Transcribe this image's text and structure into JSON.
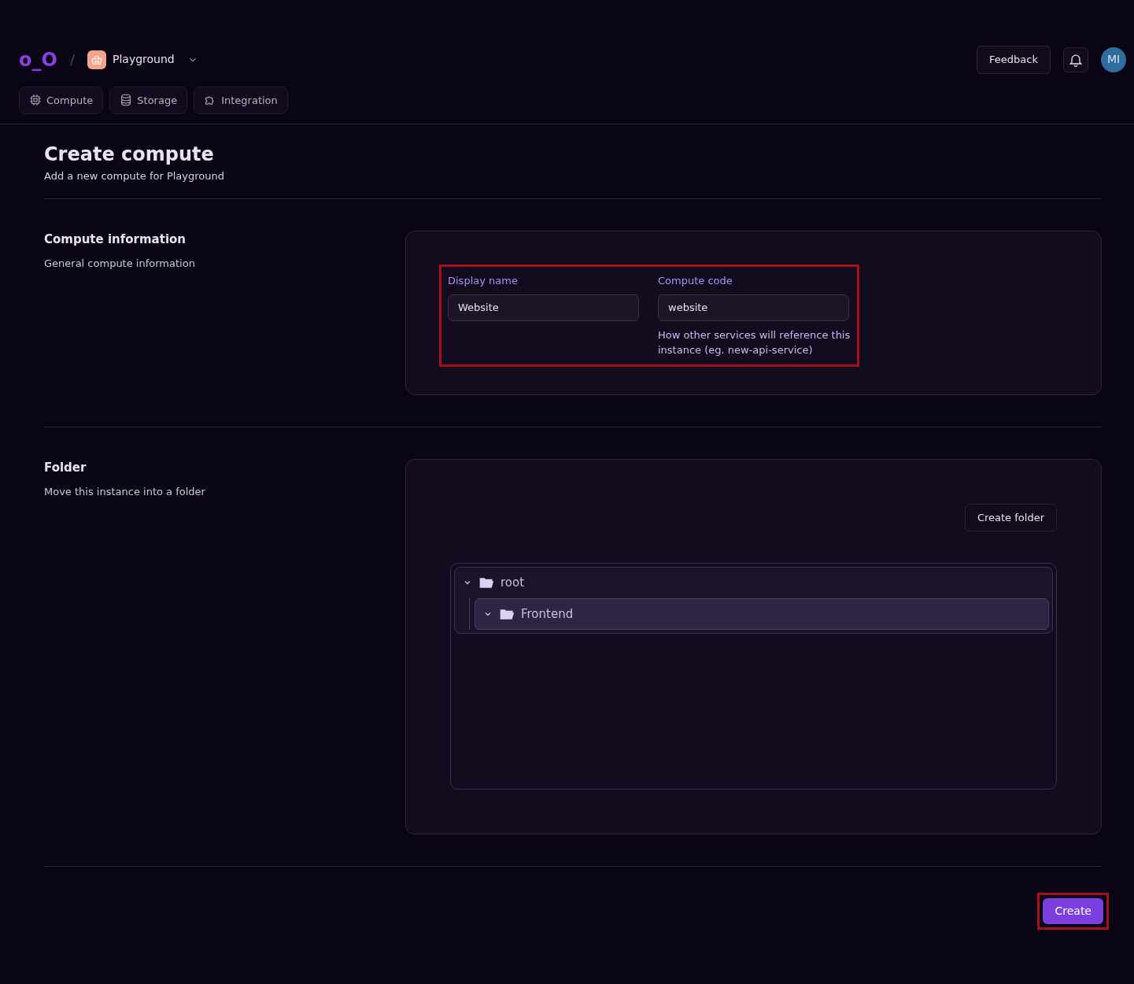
{
  "header": {
    "logo": "o_O",
    "separator": "/",
    "project": "Playground",
    "feedback": "Feedback",
    "avatar": "MI"
  },
  "tabs": [
    {
      "label": "Compute",
      "selected": false
    },
    {
      "label": "Storage",
      "selected": false
    },
    {
      "label": "Integration",
      "selected": false
    }
  ],
  "page": {
    "title": "Create compute",
    "subtitle": "Add a new compute for Playground"
  },
  "compute_information": {
    "title": "Compute information",
    "description": "General compute information",
    "highlighted": true,
    "fields": [
      {
        "label": "Display name",
        "value": "Website"
      },
      {
        "label": "Compute code",
        "value": "website",
        "help": "How other services will reference this instance (eg. new-api-service)"
      }
    ]
  },
  "folder": {
    "title": "Folder",
    "description": "Move this instance into a folder",
    "create_button": "Create folder",
    "tree": [
      {
        "label": "root",
        "expanded": true,
        "selected": false,
        "children": [
          {
            "label": "Frontend",
            "expanded": true,
            "selected": true
          }
        ]
      }
    ]
  },
  "create_button": {
    "label": "Create",
    "highlighted": true
  }
}
